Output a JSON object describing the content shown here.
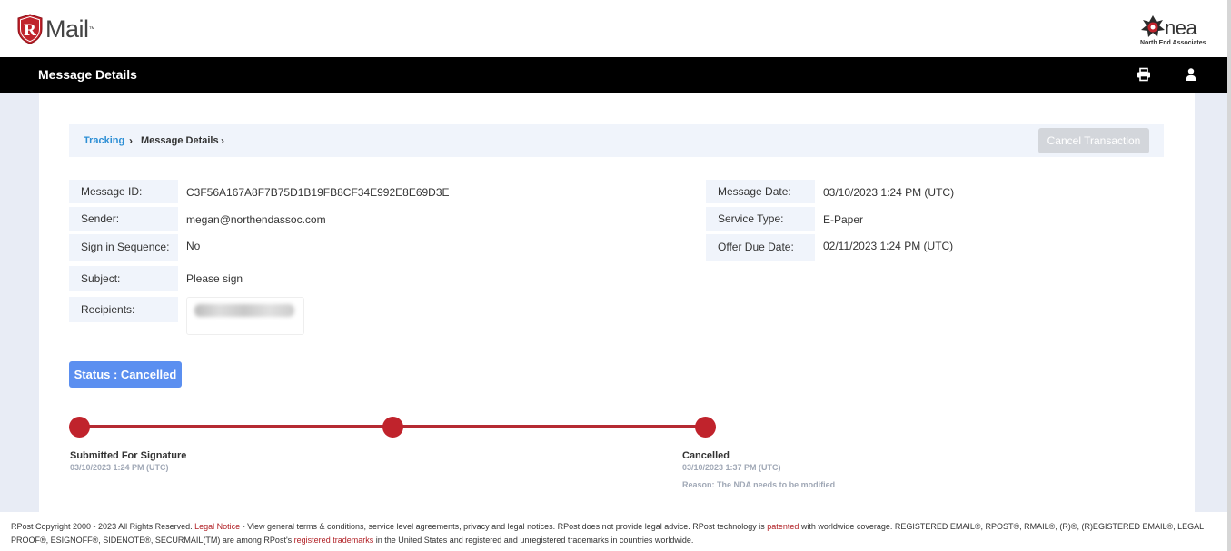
{
  "app": {
    "logo_text": "Mail",
    "logo_letter": "R",
    "logo_tm": "™",
    "brand_word": "nea",
    "brand_sub": "North End Associates"
  },
  "nav": {
    "title": "Message Details",
    "print_icon": "print-icon",
    "user_icon": "user-icon"
  },
  "breadcrumb": {
    "link": "Tracking",
    "current": "Message Details",
    "separator": "›"
  },
  "actions": {
    "cancel_label": "Cancel Transaction"
  },
  "details_left": [
    {
      "label": "Message ID:",
      "value": "C3F56A167A8F7B75D1B19FB8CF34E992E8E69D3E"
    },
    {
      "label": "Sender:",
      "value": "megan@northendassoc.com"
    },
    {
      "label": "Sign in Sequence:",
      "value": "No"
    },
    {
      "label": "Subject:",
      "value": "Please sign"
    },
    {
      "label": "Recipients:",
      "value": ""
    }
  ],
  "details_right": [
    {
      "label": "Message Date:",
      "value": "03/10/2023 1:24 PM (UTC)"
    },
    {
      "label": "Service Type:",
      "value": "E-Paper"
    },
    {
      "label": "Offer Due Date:",
      "value": "02/11/2023 1:24 PM (UTC)"
    }
  ],
  "status": {
    "label": "Status : Cancelled"
  },
  "timeline": {
    "steps": [
      {
        "title": "Submitted For Signature",
        "date": "03/10/2023 1:24 PM (UTC)"
      },
      {
        "title": "",
        "date": ""
      },
      {
        "title": "Cancelled",
        "date": "03/10/2023 1:37 PM (UTC)",
        "reason": "Reason: The NDA needs to be modified"
      }
    ],
    "color": "#c0232c"
  },
  "footer": {
    "part1": "RPost Copyright 2000 - 2023 All Rights Reserved. ",
    "legal_link": "Legal Notice",
    "part2": " - View general terms & conditions, service level agreements, privacy and legal notices. RPost does not provide legal advice. RPost technology is ",
    "patented_link": "patented",
    "part3": " with worldwide coverage. REGISTERED EMAIL®, RPOST®, RMAIL®, (R)®, (R)EGISTERED EMAIL®, LEGAL PROOF®, ESIGNOFF®, SIDENOTE®, SECURMAIL(TM) are among RPost's ",
    "trademarks_link": "registered trademarks",
    "part4": " in the United States and registered and unregistered trademarks in countries worldwide."
  },
  "colors": {
    "nav_bg": "#000000",
    "accent_link": "#2d8fd5",
    "status_bg": "#5b8ff0",
    "timeline": "#c0232c",
    "footer_link": "#b01f24"
  }
}
